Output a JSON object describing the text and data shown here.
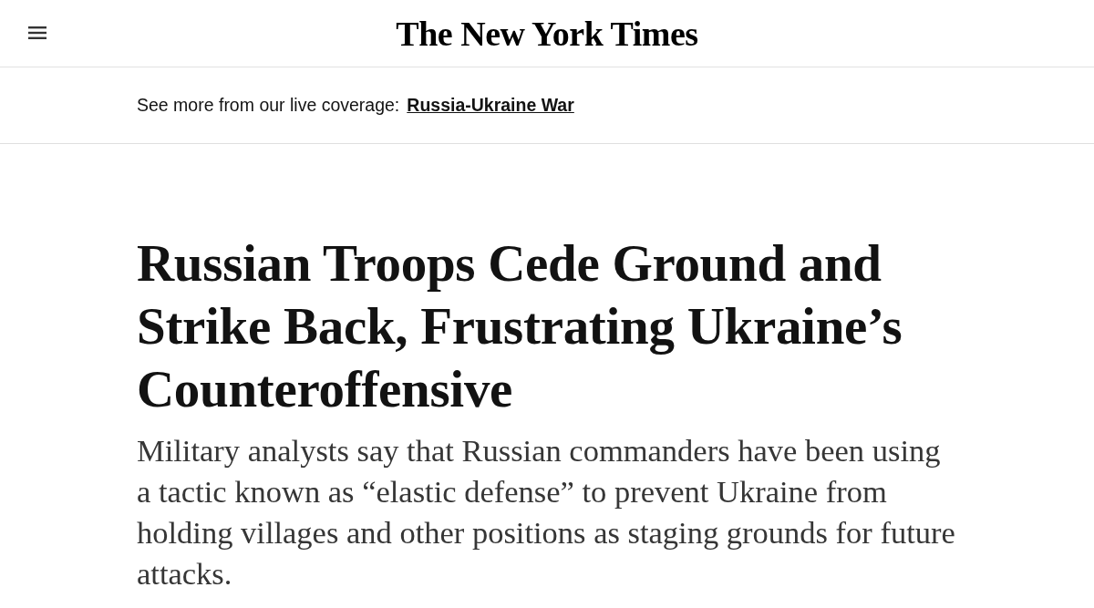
{
  "header": {
    "logo": "The New York Times"
  },
  "live_coverage": {
    "label": "See more from our live coverage:",
    "link": "Russia-Ukraine War"
  },
  "article": {
    "headline": "Russian Troops Cede Ground and Strike Back, Frustrating Ukraine’s Counteroffensive",
    "summary": "Military analysts say that Russian commanders have been using a tactic known as “elastic defense” to prevent Ukraine from holding villages and other positions as staging grounds for future attacks."
  }
}
